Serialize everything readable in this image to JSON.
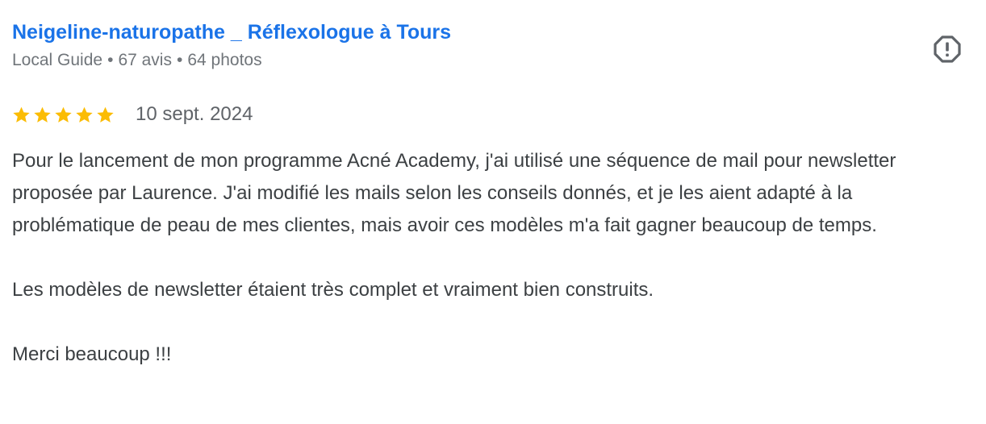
{
  "review": {
    "author_name": "Neigeline-naturopathe _ Réflexologue à Tours",
    "author_badge": "Local Guide",
    "meta_separator": "•",
    "review_count": "67 avis",
    "photo_count": "64 photos",
    "rating": 5,
    "rating_max": 5,
    "date": "10 sept. 2024",
    "paragraphs": [
      "Pour le lancement de mon programme Acné Academy, j'ai utilisé une séquence de mail pour newsletter proposée par Laurence. J'ai modifié les mails selon les conseils donnés, et je les aient adapté à la problématique de peau de mes clientes, mais avoir ces modèles m'a fait gagner beaucoup de temps.",
      "Les modèles de newsletter étaient très complet et vraiment bien construits.",
      "Merci beaucoup !!!"
    ]
  },
  "icons": {
    "report": "report-flag-icon",
    "star": "star-icon"
  },
  "colors": {
    "link": "#1a73e8",
    "star": "#fbbc04",
    "meta": "#70757a",
    "text": "#3c4043",
    "icon": "#5f6368"
  }
}
